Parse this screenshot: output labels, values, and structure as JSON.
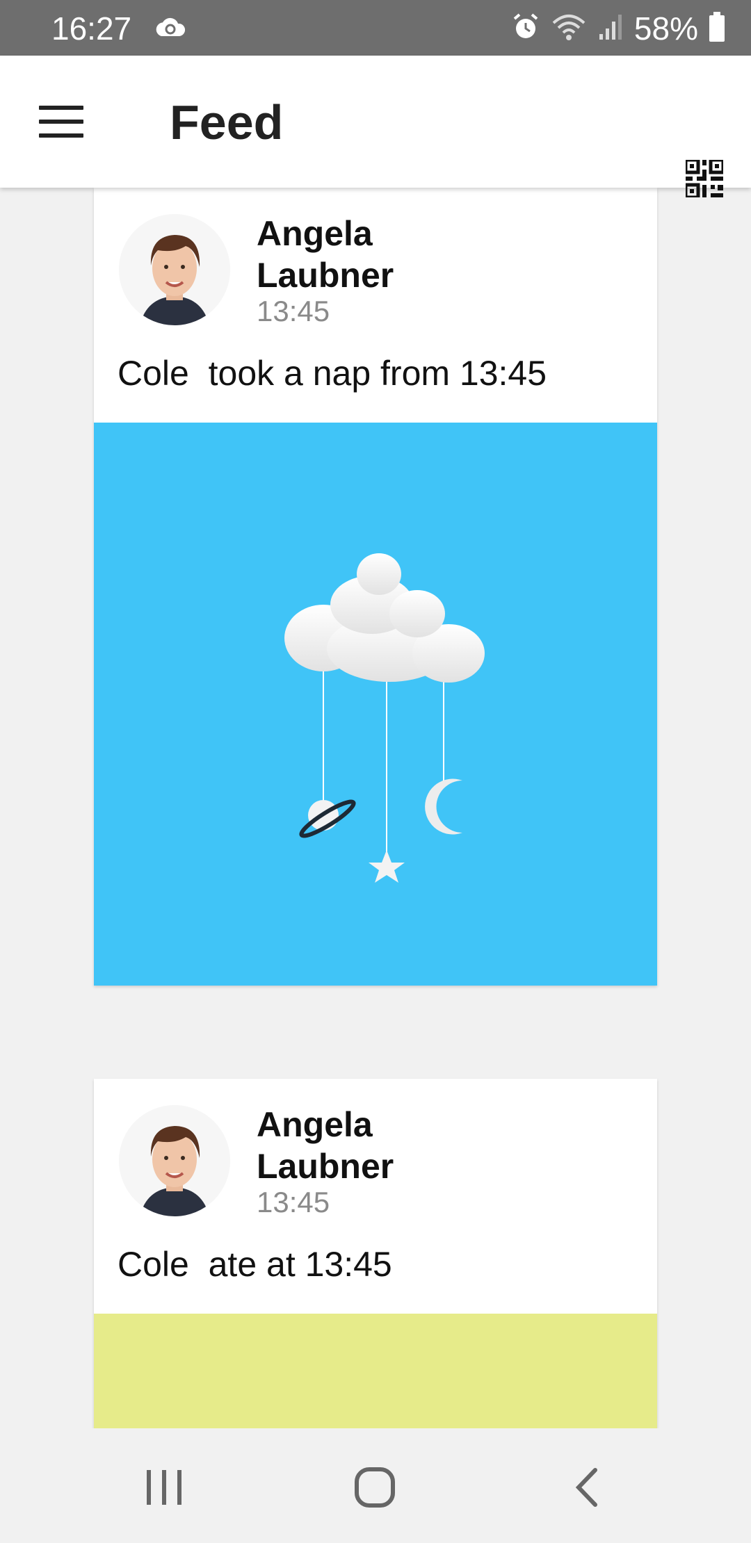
{
  "status_bar": {
    "time": "16:27",
    "battery": "58%",
    "icons": [
      "cloud-sync-icon",
      "alarm-icon",
      "wifi-icon",
      "signal-icon",
      "battery-icon"
    ]
  },
  "app_bar": {
    "title": "Feed",
    "menu_icon": "hamburger-menu-icon",
    "action_icon": "qr-code-icon"
  },
  "feed": {
    "posts": [
      {
        "author": "Angela Laubner",
        "time": "13:45",
        "text": "Cole  took a nap from 13:45",
        "image": "nap-cloud-mobile-illustration",
        "image_color": "#40c4f7"
      },
      {
        "author": "Angela Laubner",
        "time": "13:45",
        "text": "Cole  ate at 13:45",
        "image": "meal-illustration",
        "image_color": "#e6eb8a"
      }
    ]
  },
  "nav_bar": {
    "icons": [
      "recents-icon",
      "home-icon",
      "back-icon"
    ]
  }
}
